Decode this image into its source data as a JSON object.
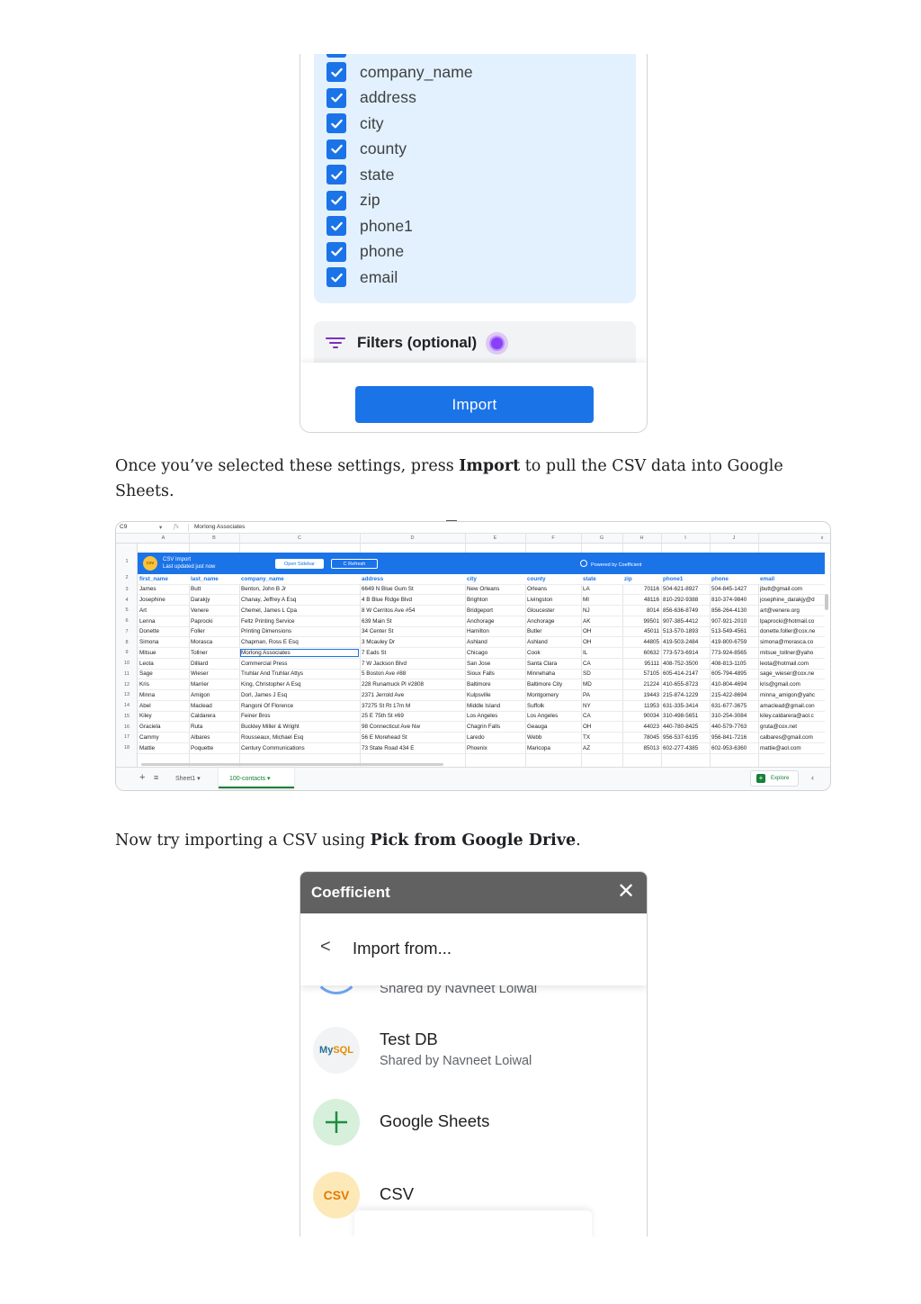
{
  "columns_panel": {
    "columns": [
      "company_name",
      "address",
      "city",
      "county",
      "state",
      "zip",
      "phone1",
      "phone",
      "email"
    ],
    "filters_label": "Filters (optional)",
    "import_button": "Import",
    "accent_color": "#1b73e8"
  },
  "paragraph1": {
    "before": "Once you’ve selected these settings, press ",
    "bold": "Import",
    "after": " to pull the CSV data into Google Sheets."
  },
  "spreadsheet": {
    "cell_ref": "C9",
    "formula_value": "Morlong Associates",
    "column_letters": [
      "A",
      "B",
      "C",
      "D",
      "E",
      "F",
      "G",
      "H",
      "I",
      "J"
    ],
    "close_x": "x",
    "banner": {
      "logo": "csv",
      "title": "CSV Import",
      "subtitle": "Last updated just now",
      "open_sidebar": "Open Sidebar",
      "refresh": "C Refresh",
      "powered_by": "Powered by Coefficient"
    },
    "headers": [
      "first_name",
      "last_name",
      "company_name",
      "address",
      "city",
      "county",
      "state",
      "zip",
      "phone1",
      "phone",
      "email"
    ],
    "rows": [
      [
        "James",
        "Butt",
        "Benton, John B Jr",
        "6649 N Blue Gum St",
        "New Orleans",
        "Orleans",
        "LA",
        "70116",
        "504-621-8927",
        "504-845-1427",
        "jbutt@gmail.com"
      ],
      [
        "Josephine",
        "Darakjy",
        "Chanay, Jeffrey A Esq",
        "4 B Blue Ridge Blvd",
        "Brighton",
        "Livingston",
        "MI",
        "48116",
        "810-292-9388",
        "810-374-9840",
        "josephine_darakjy@d"
      ],
      [
        "Art",
        "Venere",
        "Chemel, James L Cpa",
        "8 W Cerritos Ave #54",
        "Bridgeport",
        "Gloucester",
        "NJ",
        "8014",
        "856-636-8749",
        "856-264-4130",
        "art@venere.org"
      ],
      [
        "Lenna",
        "Paprocki",
        "Feltz Printing Service",
        "639 Main St",
        "Anchorage",
        "Anchorage",
        "AK",
        "99501",
        "907-385-4412",
        "907-921-2010",
        "lpaprocki@hotmail.co"
      ],
      [
        "Donette",
        "Foller",
        "Printing Dimensions",
        "34 Center St",
        "Hamilton",
        "Butler",
        "OH",
        "45011",
        "513-570-1893",
        "513-549-4561",
        "donette.foller@cox.ne"
      ],
      [
        "Simona",
        "Morasca",
        "Chapman, Ross E Esq",
        "3 Mcauley Dr",
        "Ashland",
        "Ashland",
        "OH",
        "44805",
        "419-503-2484",
        "419-800-6759",
        "simona@morasca.co"
      ],
      [
        "Mitsue",
        "Tollner",
        "Morlong Associates",
        "7 Eads St",
        "Chicago",
        "Cook",
        "IL",
        "60632",
        "773-573-6914",
        "773-924-8565",
        "mitsue_tollner@yaho"
      ],
      [
        "Leota",
        "Dilliard",
        "Commercial Press",
        "7 W Jackson Blvd",
        "San Jose",
        "Santa Clara",
        "CA",
        "95111",
        "408-752-3500",
        "408-813-1105",
        "leota@hotmail.com"
      ],
      [
        "Sage",
        "Wieser",
        "Truhlar And Truhlar Attys",
        "5 Boston Ave #88",
        "Sioux Falls",
        "Minnehaha",
        "SD",
        "57105",
        "605-414-2147",
        "605-794-4895",
        "sage_wieser@cox.ne"
      ],
      [
        "Kris",
        "Marrier",
        "King, Christopher A Esq",
        "228 Runamuck Pl #2808",
        "Baltimore",
        "Baltimore City",
        "MD",
        "21224",
        "410-655-8723",
        "410-804-4694",
        "kris@gmail.com"
      ],
      [
        "Minna",
        "Amigon",
        "Dorl, James J Esq",
        "2371 Jerrold Ave",
        "Kulpsville",
        "Montgomery",
        "PA",
        "19443",
        "215-874-1229",
        "215-422-8694",
        "minna_amigon@yahc"
      ],
      [
        "Abel",
        "Maclead",
        "Rangoni Of Florence",
        "37275 St  Rt 17m M",
        "Middle Island",
        "Suffolk",
        "NY",
        "11953",
        "631-335-3414",
        "631-677-3675",
        "amaclead@gmail.con"
      ],
      [
        "Kiley",
        "Caldarera",
        "Feiner Bros",
        "25 E 75th St #69",
        "Los Angeles",
        "Los Angeles",
        "CA",
        "90034",
        "310-498-5651",
        "310-254-3084",
        "kiley.caldarera@aol.c"
      ],
      [
        "Graciela",
        "Ruta",
        "Buckley Miller & Wright",
        "98 Connecticut Ave Nw",
        "Chagrin Falls",
        "Geauga",
        "OH",
        "44023",
        "440-780-8425",
        "440-579-7763",
        "gruta@cox.net"
      ],
      [
        "Cammy",
        "Albares",
        "Rousseaux, Michael Esq",
        "56 E Morehead St",
        "Laredo",
        "Webb",
        "TX",
        "78045",
        "956-537-6195",
        "956-841-7216",
        "calbares@gmail.com"
      ],
      [
        "Mattie",
        "Poquette",
        "Century Communications",
        "73 State Road 434 E",
        "Phoenix",
        "Maricopa",
        "AZ",
        "85013",
        "602-277-4385",
        "602-953-6360",
        "mattie@aol.com"
      ]
    ],
    "selected_cell": {
      "row": 6,
      "col": 2
    },
    "tabs": {
      "add": "+",
      "menu": "≡",
      "sheet1": "Sheet1 ▾",
      "active": "100-contacts ▾",
      "explore": "Explore",
      "arrow": "‹"
    }
  },
  "paragraph2": {
    "before": "Now try importing a CSV using ",
    "bold": "Pick from Google Drive",
    "after": "."
  },
  "coefficient_panel": {
    "title": "Coefficient",
    "close": "✕",
    "back": "<",
    "subtitle": "Import from...",
    "partial_source_sub": "Shared by Navneet Loiwal",
    "sources": [
      {
        "name": "Test DB",
        "sub": "Shared by Navneet Loiwal",
        "icon": "mysql-icon"
      },
      {
        "name": "Google Sheets",
        "sub": "",
        "icon": "plus-icon"
      },
      {
        "name": "CSV",
        "sub": "",
        "icon": "csv-icon"
      }
    ],
    "mysql_label": {
      "my": "My",
      "sql": "SQL"
    },
    "csv_icon_label": "CSV",
    "header_color": "#616161"
  }
}
